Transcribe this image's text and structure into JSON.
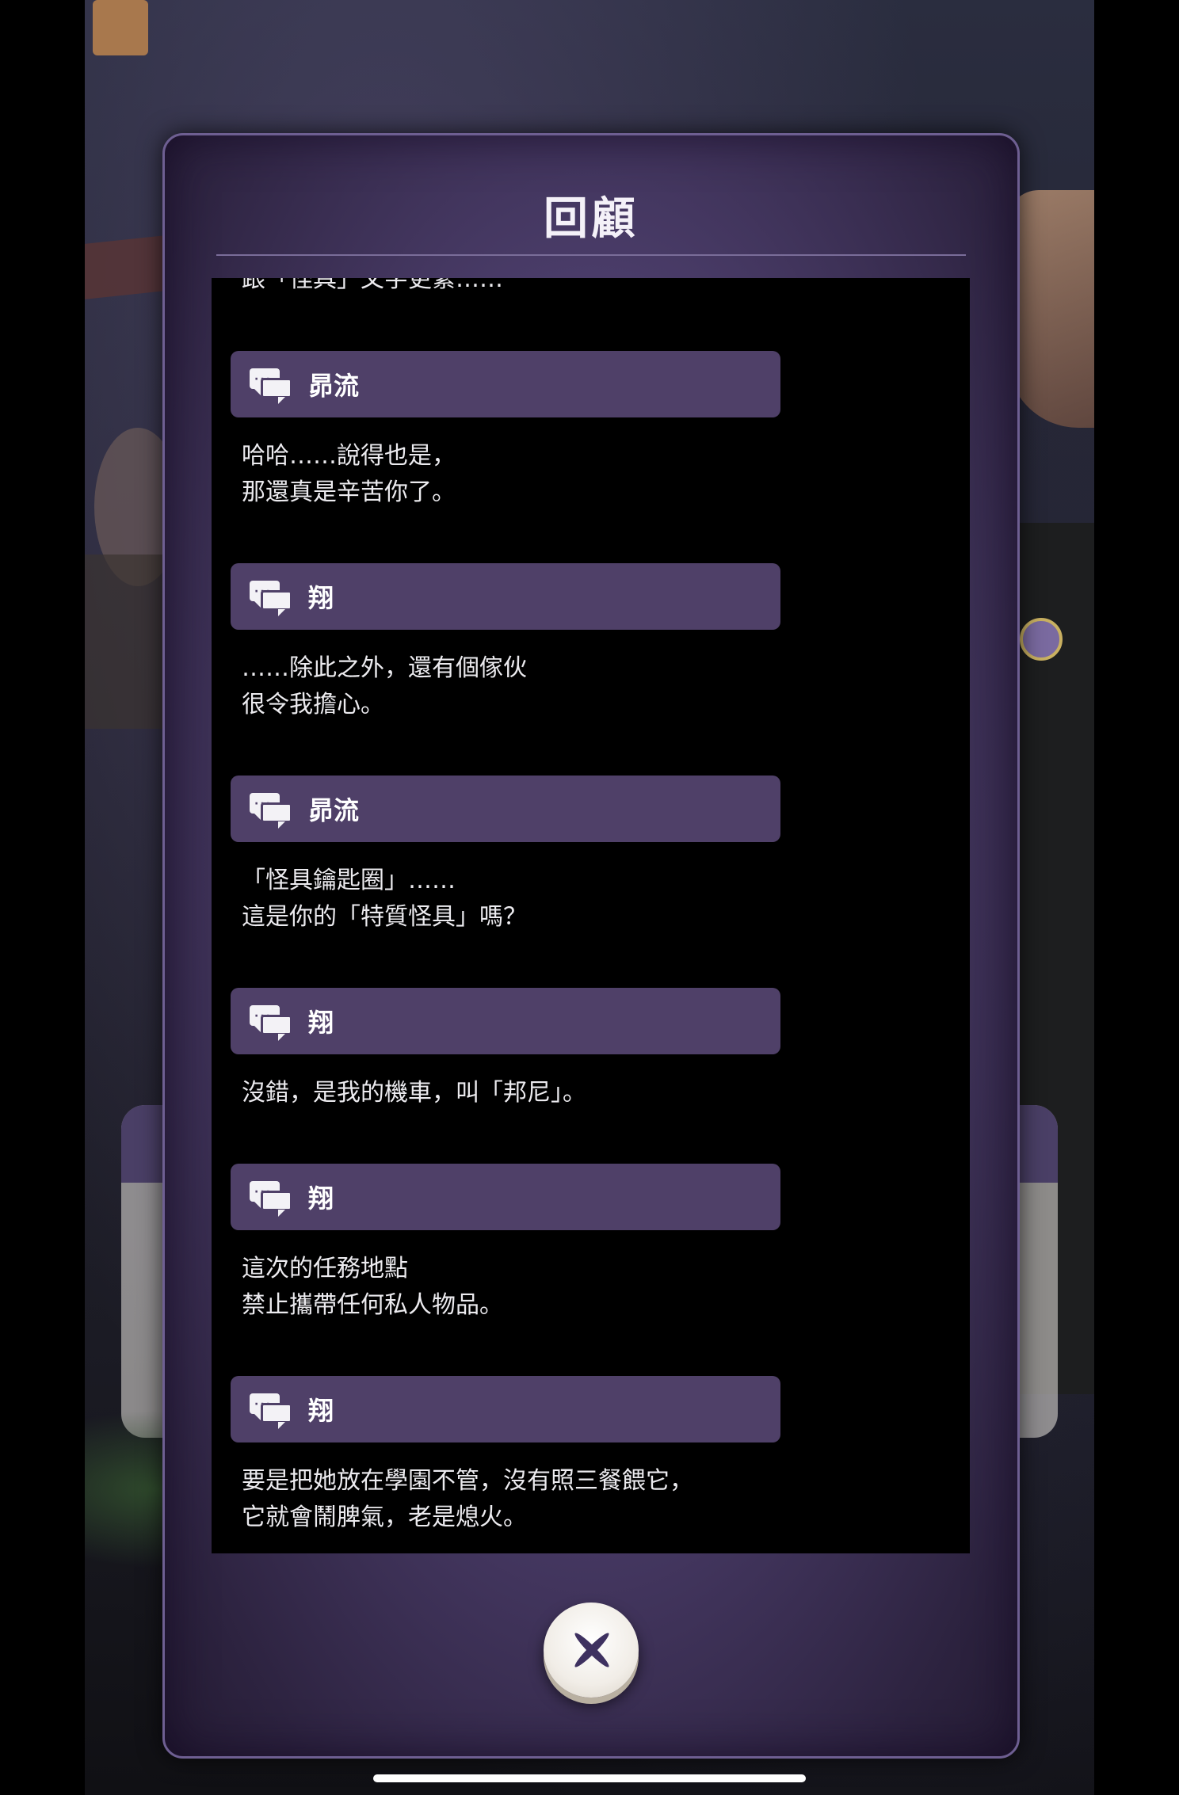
{
  "panel": {
    "title": "回顧",
    "partial_top_line": "跟「怪具」父字更緊……"
  },
  "log": [
    {
      "speaker": "昴流",
      "lines": [
        "哈哈……說得也是，",
        "那還真是辛苦你了。"
      ]
    },
    {
      "speaker": "翔",
      "lines": [
        "……除此之外，還有個傢伙",
        "很令我擔心。"
      ]
    },
    {
      "speaker": "昴流",
      "lines": [
        "「怪具鑰匙圈」……",
        "這是你的「特質怪具」嗎？"
      ]
    },
    {
      "speaker": "翔",
      "lines": [
        "沒錯，是我的機車，叫「邦尼」。"
      ]
    },
    {
      "speaker": "翔",
      "lines": [
        "這次的任務地點",
        "禁止攜帶任何私人物品。"
      ]
    },
    {
      "speaker": "翔",
      "lines": [
        "要是把她放在學園不管，沒有照三餐餵它，",
        "它就會鬧脾氣，老是熄火。"
      ]
    }
  ],
  "icons": {
    "speaker_icon": "chat-bubbles-icon",
    "close_icon": "close-x-icon"
  },
  "colors": {
    "panel_purple": "#4b3d6a",
    "name_bar": "#4f4068",
    "log_background": "#000000",
    "text": "#ecebef"
  }
}
